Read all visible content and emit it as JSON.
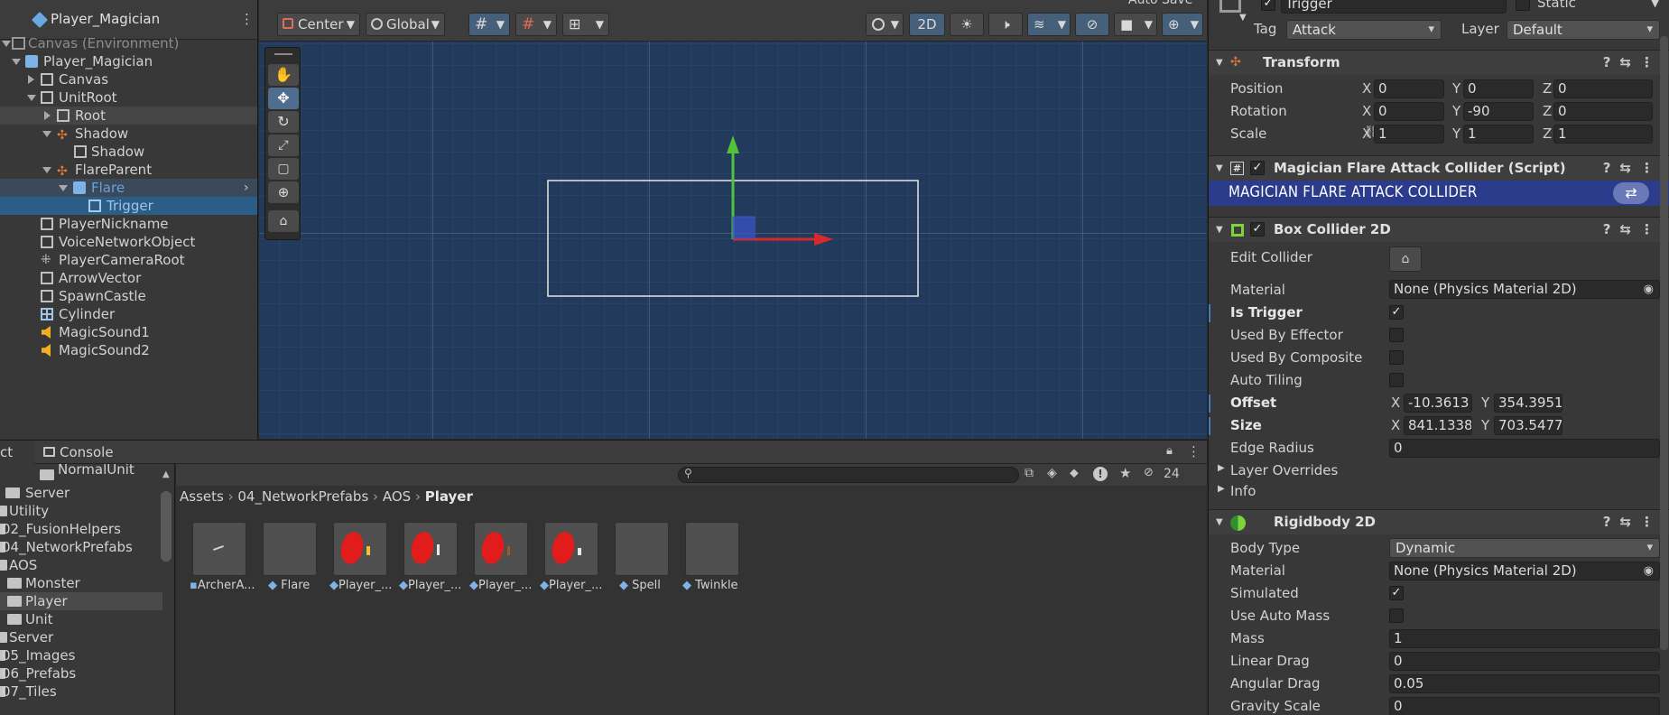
{
  "hierarchy": {
    "title": "Player_Magician",
    "rows": [
      {
        "label": "Canvas (Environment)"
      },
      {
        "label": "Player_Magician"
      },
      {
        "label": "Canvas"
      },
      {
        "label": "UnitRoot"
      },
      {
        "label": "Root"
      },
      {
        "label": "Shadow"
      },
      {
        "label": "Shadow"
      },
      {
        "label": "FlareParent"
      },
      {
        "label": "Flare"
      },
      {
        "label": "Trigger"
      },
      {
        "label": "PlayerNickname"
      },
      {
        "label": "VoiceNetworkObject"
      },
      {
        "label": "PlayerCameraRoot"
      },
      {
        "label": "ArrowVector"
      },
      {
        "label": "SpawnCastle"
      },
      {
        "label": "Cylinder"
      },
      {
        "label": "MagicSound1"
      },
      {
        "label": "MagicSound2"
      }
    ]
  },
  "scene_toolbar": {
    "pivot": "Center",
    "space": "Global",
    "mode_2d": "2D"
  },
  "project": {
    "tab_project": "ct",
    "tab_console": "Console",
    "hidden_count": "24",
    "breadcrumb": [
      "Assets",
      "04_NetworkPrefabs",
      "AOS",
      "Player"
    ],
    "folders": [
      {
        "label": "NormalUnit"
      },
      {
        "label": "Server"
      },
      {
        "label": "Utility"
      },
      {
        "label": "02_FusionHelpers"
      },
      {
        "label": "04_NetworkPrefabs"
      },
      {
        "label": "AOS"
      },
      {
        "label": "Monster"
      },
      {
        "label": "Player"
      },
      {
        "label": "Unit"
      },
      {
        "label": "Server"
      },
      {
        "label": "05_Images"
      },
      {
        "label": "06_Prefabs"
      },
      {
        "label": "07_Tiles"
      }
    ],
    "assets": [
      {
        "label": "ArcherA..."
      },
      {
        "label": "Flare"
      },
      {
        "label": "Player_..."
      },
      {
        "label": "Player_..."
      },
      {
        "label": "Player_..."
      },
      {
        "label": "Player_..."
      },
      {
        "label": "Spell"
      },
      {
        "label": "Twinkle"
      }
    ]
  },
  "inspector": {
    "object_name": "Trigger",
    "static_label": "Static",
    "tag_label": "Tag",
    "tag_value": "Attack",
    "layer_label": "Layer",
    "layer_value": "Default",
    "top_right_text": "Auto Save",
    "transform": {
      "title": "Transform",
      "position_label": "Position",
      "rotation_label": "Rotation",
      "scale_label": "Scale",
      "position": {
        "x": "0",
        "y": "0",
        "z": "0"
      },
      "rotation": {
        "x": "0",
        "y": "-90",
        "z": "0"
      },
      "scale": {
        "x": "1",
        "y": "1",
        "z": "1"
      }
    },
    "script": {
      "title": "Magician Flare Attack Collider (Script)",
      "banner": "MAGICIAN FLARE ATTACK COLLIDER"
    },
    "box_collider": {
      "title": "Box Collider 2D",
      "edit_collider": "Edit Collider",
      "material_label": "Material",
      "material_value": "None (Physics Material 2D)",
      "is_trigger": "Is Trigger",
      "used_by_effector": "Used By Effector",
      "used_by_composite": "Used By Composite",
      "auto_tiling": "Auto Tiling",
      "offset_label": "Offset",
      "offset_x": "-10.3613",
      "offset_y": "354.3951",
      "size_label": "Size",
      "size_x": "841.1338",
      "size_y": "703.5477",
      "edge_radius_label": "Edge Radius",
      "edge_radius_value": "0",
      "layer_overrides": "Layer Overrides",
      "info": "Info"
    },
    "rigidbody": {
      "title": "Rigidbody 2D",
      "body_type_label": "Body Type",
      "body_type_value": "Dynamic",
      "material_label": "Material",
      "material_value": "None (Physics Material 2D)",
      "simulated": "Simulated",
      "use_auto_mass": "Use Auto Mass",
      "mass_label": "Mass",
      "mass_value": "1",
      "linear_drag_label": "Linear Drag",
      "linear_drag_value": "0",
      "angular_drag_label": "Angular Drag",
      "angular_drag_value": "0.05",
      "gravity_scale_label": "Gravity Scale",
      "gravity_scale_value": "0"
    }
  },
  "colors": {
    "selection": "#2c5d87",
    "scene_bg": "#223a5b",
    "script_banner": "#2b3c8c",
    "gizmo_y": "#53c13a",
    "gizmo_x": "#d62a2a"
  }
}
